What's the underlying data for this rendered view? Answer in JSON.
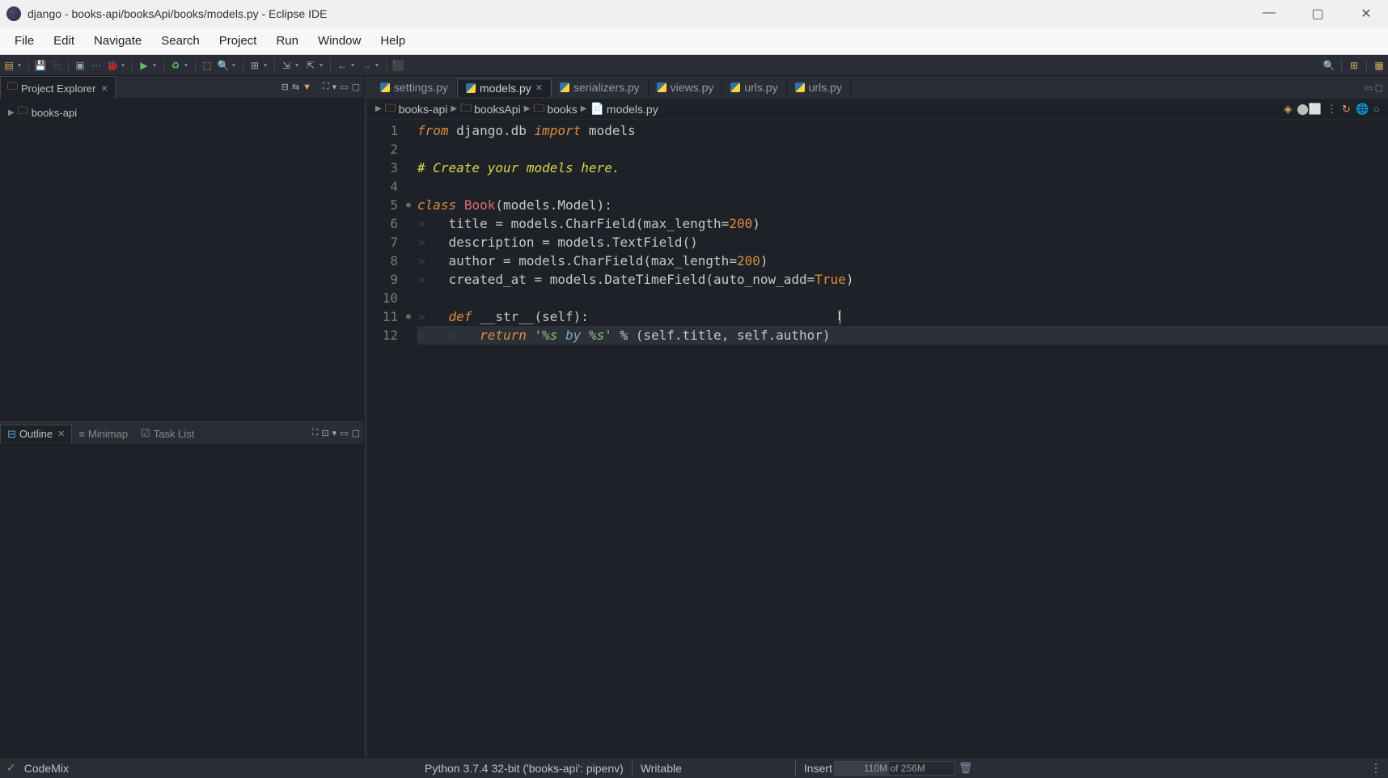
{
  "window": {
    "title": "django - books-api/booksApi/books/models.py - Eclipse IDE"
  },
  "menu": [
    "File",
    "Edit",
    "Navigate",
    "Search",
    "Project",
    "Run",
    "Window",
    "Help"
  ],
  "projectExplorer": {
    "title": "Project Explorer",
    "root": "books-api"
  },
  "outline": {
    "title": "Outline",
    "tabs": [
      "Outline",
      "Minimap",
      "Task List"
    ]
  },
  "editor": {
    "tabs": [
      {
        "label": "settings.py",
        "active": false
      },
      {
        "label": "models.py",
        "active": true
      },
      {
        "label": "serializers.py",
        "active": false
      },
      {
        "label": "views.py",
        "active": false
      },
      {
        "label": "urls.py",
        "active": false
      },
      {
        "label": "urls.py",
        "active": false
      }
    ],
    "breadcrumb": [
      "books-api",
      "booksApi",
      "books",
      "models.py"
    ],
    "code": [
      {
        "n": 1,
        "tokens": [
          {
            "t": "kw",
            "v": "from"
          },
          {
            "t": "id",
            "v": " django.db "
          },
          {
            "t": "kw",
            "v": "import"
          },
          {
            "t": "id",
            "v": " models"
          }
        ]
      },
      {
        "n": 2,
        "tokens": []
      },
      {
        "n": 3,
        "tokens": [
          {
            "t": "cm",
            "v": "# Create your models here."
          }
        ]
      },
      {
        "n": 4,
        "tokens": []
      },
      {
        "n": 5,
        "fold": "●",
        "tokens": [
          {
            "t": "kw",
            "v": "class"
          },
          {
            "t": "id",
            "v": " "
          },
          {
            "t": "cls",
            "v": "Book"
          },
          {
            "t": "id",
            "v": "(models.Model):"
          }
        ]
      },
      {
        "n": 6,
        "ws": "»   ",
        "tokens": [
          {
            "t": "id",
            "v": "title = models.CharField(max_length="
          },
          {
            "t": "num",
            "v": "200"
          },
          {
            "t": "id",
            "v": ")"
          }
        ]
      },
      {
        "n": 7,
        "ws": "»   ",
        "tokens": [
          {
            "t": "id",
            "v": "description = models.TextField()"
          }
        ]
      },
      {
        "n": 8,
        "ws": "»   ",
        "tokens": [
          {
            "t": "id",
            "v": "author = models.CharField(max_length="
          },
          {
            "t": "num",
            "v": "200"
          },
          {
            "t": "id",
            "v": ")"
          }
        ]
      },
      {
        "n": 9,
        "ws": "»   ",
        "tokens": [
          {
            "t": "id",
            "v": "created_at = models.DateTimeField(auto_now_add="
          },
          {
            "t": "num",
            "v": "True"
          },
          {
            "t": "id",
            "v": ")"
          }
        ]
      },
      {
        "n": 10,
        "tokens": []
      },
      {
        "n": 11,
        "fold": "●",
        "ws": "»   ",
        "tokens": [
          {
            "t": "kw",
            "v": "def"
          },
          {
            "t": "id",
            "v": " __str__(self):"
          }
        ]
      },
      {
        "n": 12,
        "hl": true,
        "ws": "»   »   ",
        "tokens": [
          {
            "t": "kw",
            "v": "return"
          },
          {
            "t": "id",
            "v": " "
          },
          {
            "t": "str",
            "v": "'%s "
          },
          {
            "t": "str-em",
            "v": "by"
          },
          {
            "t": "str",
            "v": " %s'"
          },
          {
            "t": "id",
            "v": " % (self.title, self.author)"
          }
        ]
      }
    ]
  },
  "status": {
    "codemix": "CodeMix",
    "python": "Python 3.7.4 32-bit ('books-api': pipenv)",
    "writable": "Writable",
    "insert": "Insert",
    "memory": "110M of 256M"
  }
}
